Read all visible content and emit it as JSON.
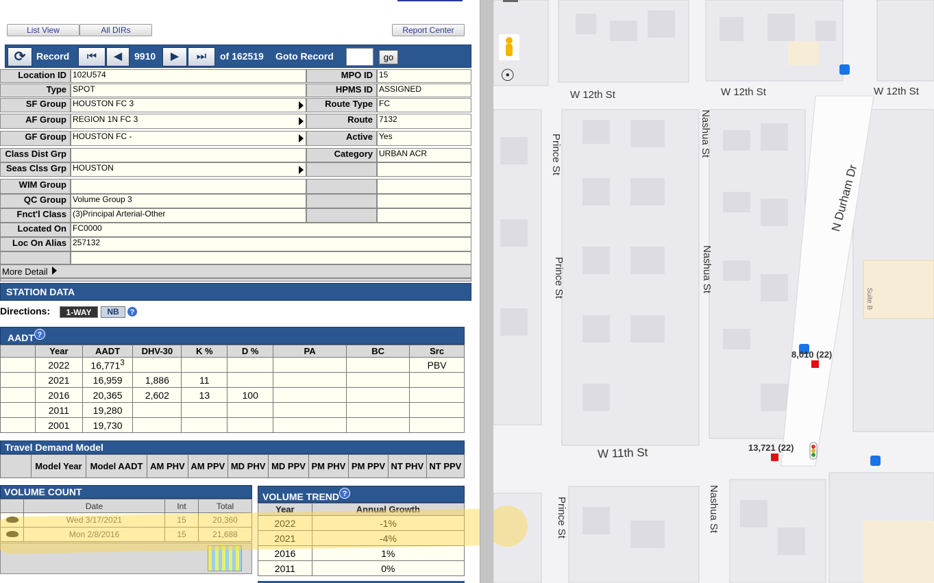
{
  "toolbar": {
    "list_view": "List View",
    "all_dirs": "All DIRs",
    "report_center": "Report Center"
  },
  "record_bar": {
    "record_label": "Record",
    "record_number": "9910",
    "of_total": "of 162519",
    "goto_label": "Goto Record",
    "goto_value": "",
    "go_label": "go"
  },
  "info": {
    "location_id": {
      "label": "Location ID",
      "value": "102U574"
    },
    "mpo_id": {
      "label": "MPO ID",
      "value": "15"
    },
    "type": {
      "label": "Type",
      "value": "SPOT"
    },
    "hpms_id": {
      "label": "HPMS ID",
      "value": "ASSIGNED"
    },
    "sf_group": {
      "label": "SF Group",
      "value": "HOUSTON FC 3"
    },
    "route_type": {
      "label": "Route Type",
      "value": "FC"
    },
    "af_group": {
      "label": "AF Group",
      "value": "REGION 1N FC 3"
    },
    "route": {
      "label": "Route",
      "value": "7132"
    },
    "gf_group": {
      "label": "GF Group",
      "value": "HOUSTON FC -"
    },
    "active": {
      "label": "Active",
      "value": "Yes"
    },
    "class_dist_grp": {
      "label": "Class Dist Grp",
      "value": ""
    },
    "category": {
      "label": "Category",
      "value": "URBAN ACR"
    },
    "seas_clss_grp": {
      "label": "Seas Clss Grp",
      "value": "HOUSTON"
    },
    "wim_group": {
      "label": "WIM Group",
      "value": ""
    },
    "qc_group": {
      "label": "QC Group",
      "value": "Volume Group 3"
    },
    "fnctl_class": {
      "label": "Fnct'l Class",
      "value": "(3)Principal Arterial-Other"
    },
    "located_on": {
      "label": "Located On",
      "value": "FC0000"
    },
    "loc_on_alias": {
      "label": "Loc On Alias",
      "value": "257132"
    },
    "more_detail": "More Detail"
  },
  "station": {
    "title": "STATION DATA",
    "directions_label": "Directions:",
    "dir_1way": "1-WAY",
    "dir_nb": "NB"
  },
  "aadt": {
    "title": "AADT",
    "headers": [
      "Year",
      "AADT",
      "DHV-30",
      "K %",
      "D %",
      "PA",
      "BC",
      "Src"
    ],
    "rows": [
      {
        "year": "2022",
        "aadt": "16,771",
        "sup": "3",
        "dhv": "",
        "k": "",
        "d": "",
        "pa": "",
        "bc": "",
        "src": "PBV"
      },
      {
        "year": "2021",
        "aadt": "16,959",
        "sup": "",
        "dhv": "1,886",
        "k": "11",
        "d": "",
        "pa": "",
        "bc": "",
        "src": ""
      },
      {
        "year": "2016",
        "aadt": "20,365",
        "sup": "",
        "dhv": "2,602",
        "k": "13",
        "d": "100",
        "pa": "",
        "bc": "",
        "src": ""
      },
      {
        "year": "2011",
        "aadt": "19,280",
        "sup": "",
        "dhv": "",
        "k": "",
        "d": "",
        "pa": "",
        "bc": "",
        "src": ""
      },
      {
        "year": "2001",
        "aadt": "19,730",
        "sup": "",
        "dhv": "",
        "k": "",
        "d": "",
        "pa": "",
        "bc": "",
        "src": ""
      }
    ]
  },
  "tdm": {
    "title": "Travel Demand Model",
    "headers": [
      "Model Year",
      "Model AADT",
      "AM PHV",
      "AM PPV",
      "MD PHV",
      "MD PPV",
      "PM PHV",
      "PM PPV",
      "NT PHV",
      "NT PPV"
    ]
  },
  "volume_count": {
    "title": "VOLUME COUNT",
    "headers": [
      "Date",
      "Int",
      "Total"
    ],
    "rows": [
      {
        "date": "Wed 3/17/2021",
        "int": "15",
        "total": "20,360"
      },
      {
        "date": "Mon 2/8/2016",
        "int": "15",
        "total": "21,688"
      }
    ]
  },
  "volume_trend": {
    "title": "VOLUME TREND",
    "headers": [
      "Year",
      "Annual Growth"
    ],
    "rows": [
      {
        "year": "2022",
        "growth": "-1%"
      },
      {
        "year": "2021",
        "growth": "-4%"
      },
      {
        "year": "2016",
        "growth": "1%"
      },
      {
        "year": "2011",
        "growth": "0%"
      }
    ]
  },
  "map": {
    "streets": {
      "w12_a": "W 12th St",
      "w12_b": "W 12th St",
      "w12_c": "W 12th St",
      "w11": "W 11th St",
      "prince_a": "Prince St",
      "prince_b": "Prince St",
      "prince_c": "Prince St",
      "nashua_a": "Nashua St",
      "nashua_b": "Nashua St",
      "nashua_c": "Nashua St",
      "durham": "N Durham Dr",
      "suite": "Suite B"
    },
    "counts": {
      "c1": "8,010 (22)",
      "c2": "13,721 (22)"
    },
    "colors": {
      "count_marker": "#e01010",
      "transit": "#1a73e8",
      "highlight": "#ffd84a"
    }
  }
}
